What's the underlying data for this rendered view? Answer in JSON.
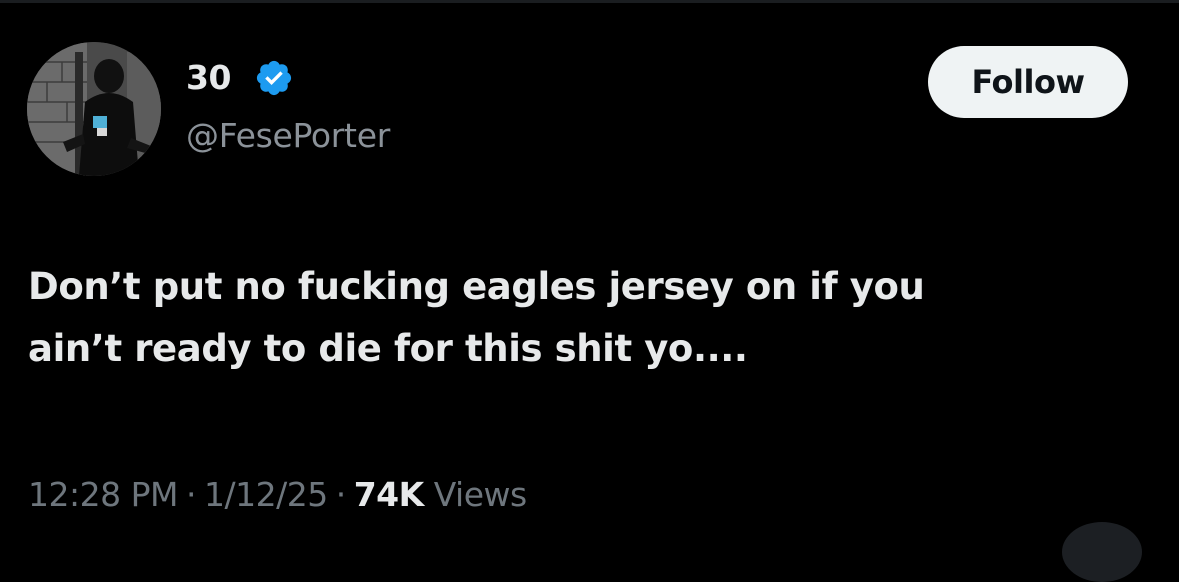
{
  "user": {
    "display_name": "30",
    "handle": "@FesePorter",
    "verified_icon": "verified-badge-icon",
    "avatar_icon": "avatar-photo"
  },
  "actions": {
    "follow_label": "Follow"
  },
  "tweet": {
    "text": "Don’t put no fucking eagles jersey on if you\nain’t ready to die for this shit yo...."
  },
  "meta": {
    "time": "12:28 PM",
    "separator": "·",
    "date": "1/12/25",
    "views_count": "74K",
    "views_label": "Views"
  },
  "colors": {
    "background": "#000000",
    "primary_text": "#e7e9ea",
    "secondary_text": "#6e767d",
    "verified": "#1d9bf0",
    "follow_button_bg": "#eff3f4"
  }
}
